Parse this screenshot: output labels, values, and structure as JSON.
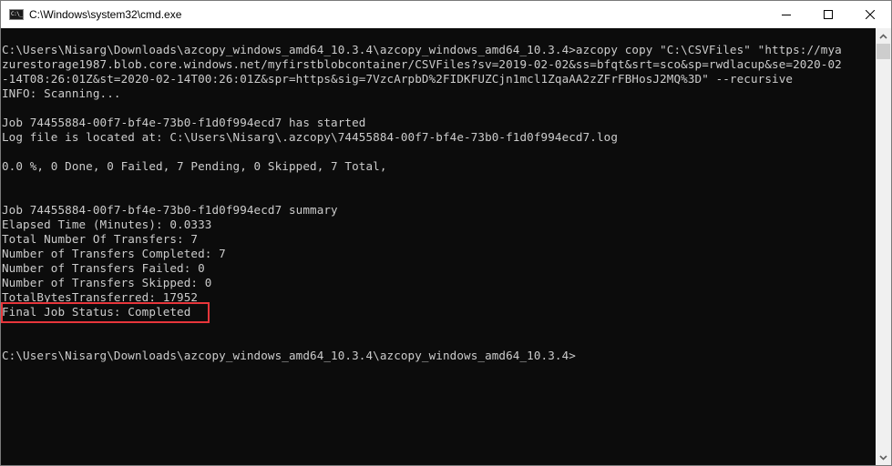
{
  "window": {
    "title": "C:\\Windows\\system32\\cmd.exe",
    "icon_label": "C:\\_",
    "controls": {
      "minimize": "minimize-icon",
      "maximize": "maximize-icon",
      "close": "close-icon"
    }
  },
  "console": {
    "lines": [
      "C:\\Users\\Nisarg\\Downloads\\azcopy_windows_amd64_10.3.4\\azcopy_windows_amd64_10.3.4>azcopy copy \"C:\\CSVFiles\" \"https://mya",
      "zurestorage1987.blob.core.windows.net/myfirstblobcontainer/CSVFiles?sv=2019-02-02&ss=bfqt&srt=sco&sp=rwdlacup&se=2020-02",
      "-14T08:26:01Z&st=2020-02-14T00:26:01Z&spr=https&sig=7VzcArpbD%2FIDKFUZCjn1mcl1ZqaAA2zZFrFBHosJ2MQ%3D\" --recursive",
      "INFO: Scanning...",
      "",
      "Job 74455884-00f7-bf4e-73b0-f1d0f994ecd7 has started",
      "Log file is located at: C:\\Users\\Nisarg\\.azcopy\\74455884-00f7-bf4e-73b0-f1d0f994ecd7.log",
      "",
      "0.0 %, 0 Done, 0 Failed, 7 Pending, 0 Skipped, 7 Total,",
      "",
      "",
      "Job 74455884-00f7-bf4e-73b0-f1d0f994ecd7 summary",
      "Elapsed Time (Minutes): 0.0333",
      "Total Number Of Transfers: 7",
      "Number of Transfers Completed: 7",
      "Number of Transfers Failed: 0",
      "Number of Transfers Skipped: 0",
      "TotalBytesTransferred: 17952",
      "Final Job Status: Completed",
      "",
      "",
      "C:\\Users\\Nisarg\\Downloads\\azcopy_windows_amd64_10.3.4\\azcopy_windows_amd64_10.3.4>"
    ],
    "highlighted_line": "Final Job Status: Completed",
    "highlight_color": "#e8363b",
    "text_color": "#cccccc",
    "background_color": "#0c0c0c"
  }
}
